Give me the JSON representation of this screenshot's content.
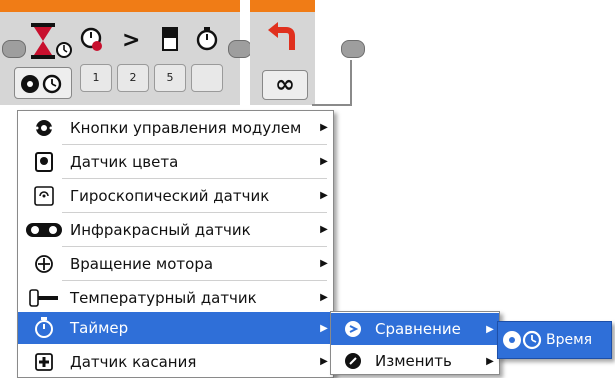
{
  "block": {
    "tabs": [
      "1",
      "2",
      "5"
    ],
    "mode_button_icons": [
      "brick-buttons-icon",
      "timer-icon"
    ],
    "loop_mode_symbol": "∞",
    "compare_symbol": ">"
  },
  "menu": {
    "items": [
      {
        "label": "Кнопки управления модулем",
        "icon": "brick-buttons-icon"
      },
      {
        "label": "Датчик цвета",
        "icon": "color-sensor-icon"
      },
      {
        "label": "Гироскопический датчик",
        "icon": "gyro-sensor-icon"
      },
      {
        "label": "Инфракрасный датчик",
        "icon": "infrared-sensor-icon"
      },
      {
        "label": "Вращение мотора",
        "icon": "motor-rotation-icon"
      },
      {
        "label": "Температурный датчик",
        "icon": "temperature-sensor-icon"
      },
      {
        "label": "Таймер",
        "icon": "timer-icon"
      },
      {
        "label": "Датчик касания",
        "icon": "touch-sensor-icon"
      }
    ],
    "selected_index": 6
  },
  "submenu": {
    "items": [
      {
        "label": "Сравнение",
        "icon": "compare-icon"
      },
      {
        "label": "Изменить",
        "icon": "change-icon"
      }
    ],
    "selected_index": 0
  },
  "subsubmenu": {
    "items": [
      {
        "label": "Время",
        "icon": "time-icon"
      }
    ]
  },
  "colors": {
    "accent_orange": "#f07c16",
    "selection_blue": "#2f6fd8"
  }
}
